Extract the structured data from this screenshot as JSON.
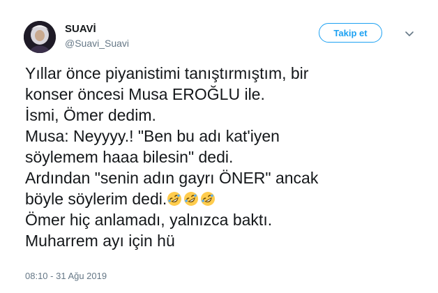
{
  "user": {
    "name": "SUAVİ",
    "handle": "@Suavi_Suavi"
  },
  "actions": {
    "follow_label": "Takip et"
  },
  "tweet": {
    "lines": [
      "Yıllar önce piyanistimi tanıştırmıştım, bir",
      "konser öncesi Musa EROĞLU ile.",
      "İsmi, Ömer dedim.",
      "Musa: Neyyyy.! \"Ben bu adı kat'iyen",
      "söylemem haaa bilesin\" dedi.",
      "Ardından \"senin adın gayrı ÖNER\" ancak",
      "böyle söylerim dedi.",
      "Ömer hiç anlamadı, yalnızca baktı.",
      "Muharrem ayı için hü"
    ],
    "emojis": [
      "rolling-on-floor-laughing-emoji",
      "rolling-on-floor-laughing-emoji",
      "rolling-on-floor-laughing-emoji"
    ]
  },
  "timestamp": "08:10 - 31 Ağu 2019",
  "colors": {
    "accent": "#1da1f2",
    "text": "#14171a",
    "muted": "#657786"
  }
}
